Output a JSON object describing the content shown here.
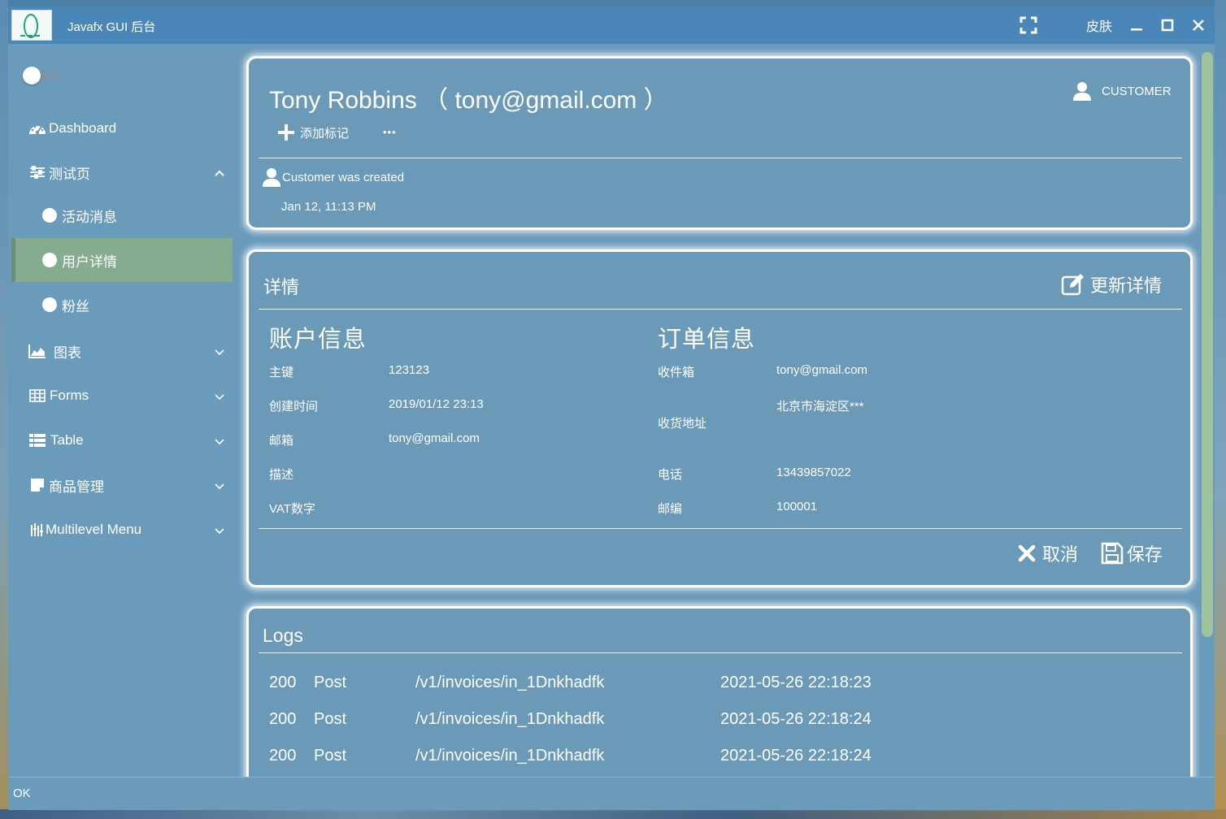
{
  "window": {
    "title": "Javafx GUI 后台",
    "skin_label": "皮肤"
  },
  "sidebar": {
    "items": [
      {
        "label": "Dashboard"
      },
      {
        "label": "测试页"
      },
      {
        "label": "活动消息"
      },
      {
        "label": "用户详情"
      },
      {
        "label": "粉丝"
      },
      {
        "label": "图表"
      },
      {
        "label": "Forms"
      },
      {
        "label": "Table"
      },
      {
        "label": "商品管理"
      },
      {
        "label": "Multilevel Menu"
      }
    ]
  },
  "profile": {
    "name_line": "Tony Robbins （ tony@gmail.com ）",
    "role": "CUSTOMER",
    "add_tag_label": "添加标记",
    "more_label": "•••",
    "event_text": "Customer was created",
    "event_time": "Jan 12, 11:13 PM"
  },
  "details": {
    "title": "详情",
    "update_label": "更新详情",
    "account": {
      "title": "账户信息",
      "rows": [
        {
          "label": "主键",
          "value": "123123"
        },
        {
          "label": "创建时间",
          "value": "2019/01/12 23:13"
        },
        {
          "label": "邮箱",
          "value": "tony@gmail.com"
        },
        {
          "label": "描述",
          "value": ""
        },
        {
          "label": "VAT数字",
          "value": ""
        }
      ]
    },
    "order": {
      "title": "订单信息",
      "rows": [
        {
          "label": "收件箱",
          "value": "tony@gmail.com"
        },
        {
          "label": "收货地址",
          "value": "北京市海淀区***"
        },
        {
          "label": "电话",
          "value": "13439857022"
        },
        {
          "label": "邮编",
          "value": "100001"
        }
      ]
    },
    "cancel_label": "取消",
    "save_label": "保存"
  },
  "logs": {
    "title": "Logs",
    "rows": [
      {
        "status": "200",
        "method": "Post",
        "path": "/v1/invoices/in_1Dnkhadfk",
        "time": "2021-05-26 22:18:23"
      },
      {
        "status": "200",
        "method": "Post",
        "path": "/v1/invoices/in_1Dnkhadfk",
        "time": "2021-05-26 22:18:24"
      },
      {
        "status": "200",
        "method": "Post",
        "path": "/v1/invoices/in_1Dnkhadfk",
        "time": "2021-05-26 22:18:24"
      }
    ]
  },
  "status": {
    "text": "OK"
  },
  "colors": {
    "titlebar": "#4b86b9",
    "panel": "#6a9bbb",
    "active_item": "#86ac8f"
  }
}
